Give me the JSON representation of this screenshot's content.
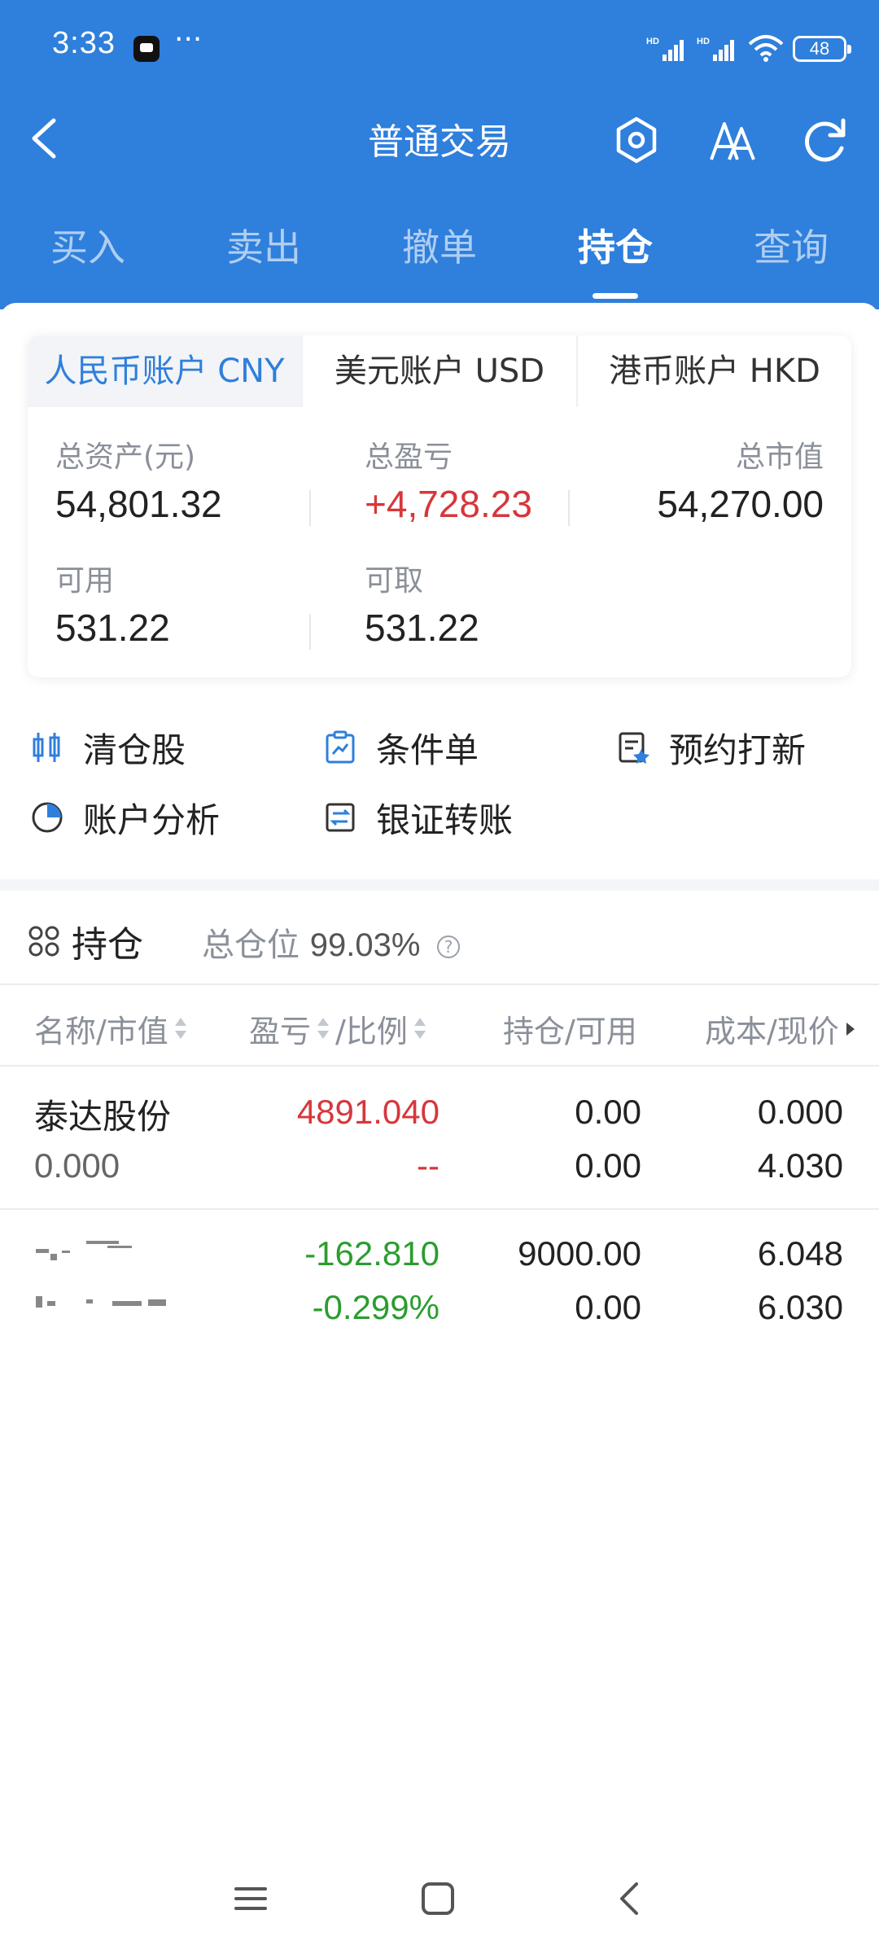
{
  "status_bar": {
    "time": "3:33",
    "dots": "···",
    "battery": "48"
  },
  "header": {
    "title": "普通交易"
  },
  "tabs": [
    {
      "label": "买入",
      "active": false
    },
    {
      "label": "卖出",
      "active": false
    },
    {
      "label": "撤单",
      "active": false
    },
    {
      "label": "持仓",
      "active": true
    },
    {
      "label": "查询",
      "active": false
    }
  ],
  "account": {
    "tabs": [
      "人民币账户 CNY",
      "美元账户 USD",
      "港币账户 HKD"
    ],
    "active_tab": 0,
    "total_assets_label": "总资产(元)",
    "total_assets": "54,801.32",
    "total_pnl_label": "总盈亏",
    "total_pnl": "+4,728.23",
    "market_value_label": "总市值",
    "market_value": "54,270.00",
    "available_label": "可用",
    "available": "531.22",
    "withdrawable_label": "可取",
    "withdrawable": "531.22"
  },
  "actions": [
    {
      "label": "清仓股",
      "icon": "clear-position-icon"
    },
    {
      "label": "条件单",
      "icon": "condition-order-icon"
    },
    {
      "label": "预约打新",
      "icon": "ipo-reservation-icon"
    },
    {
      "label": "账户分析",
      "icon": "pie-chart-icon"
    },
    {
      "label": "银证转账",
      "icon": "transfer-icon"
    }
  ],
  "positions": {
    "title": "持仓",
    "ratio_label": "总仓位",
    "ratio_value": "99.03%",
    "columns": [
      "名称/市值",
      "盈亏",
      "/比例",
      "持仓/可用",
      "成本/现价"
    ],
    "rows": [
      {
        "name": "泰达股份",
        "market_value": "0.000",
        "pnl": "4891.040",
        "ratio": "--",
        "holding": "0.00",
        "available": "0.00",
        "cost": "0.000",
        "price": "4.030"
      },
      {
        "name": "",
        "market_value": "",
        "pnl": "-162.810",
        "ratio": "-0.299%",
        "holding": "9000.00",
        "available": "0.00",
        "cost": "6.048",
        "price": "6.030"
      }
    ]
  },
  "colors": {
    "primary": "#2f7fdc",
    "profit": "#d6373b",
    "loss": "#2a9d2f"
  }
}
